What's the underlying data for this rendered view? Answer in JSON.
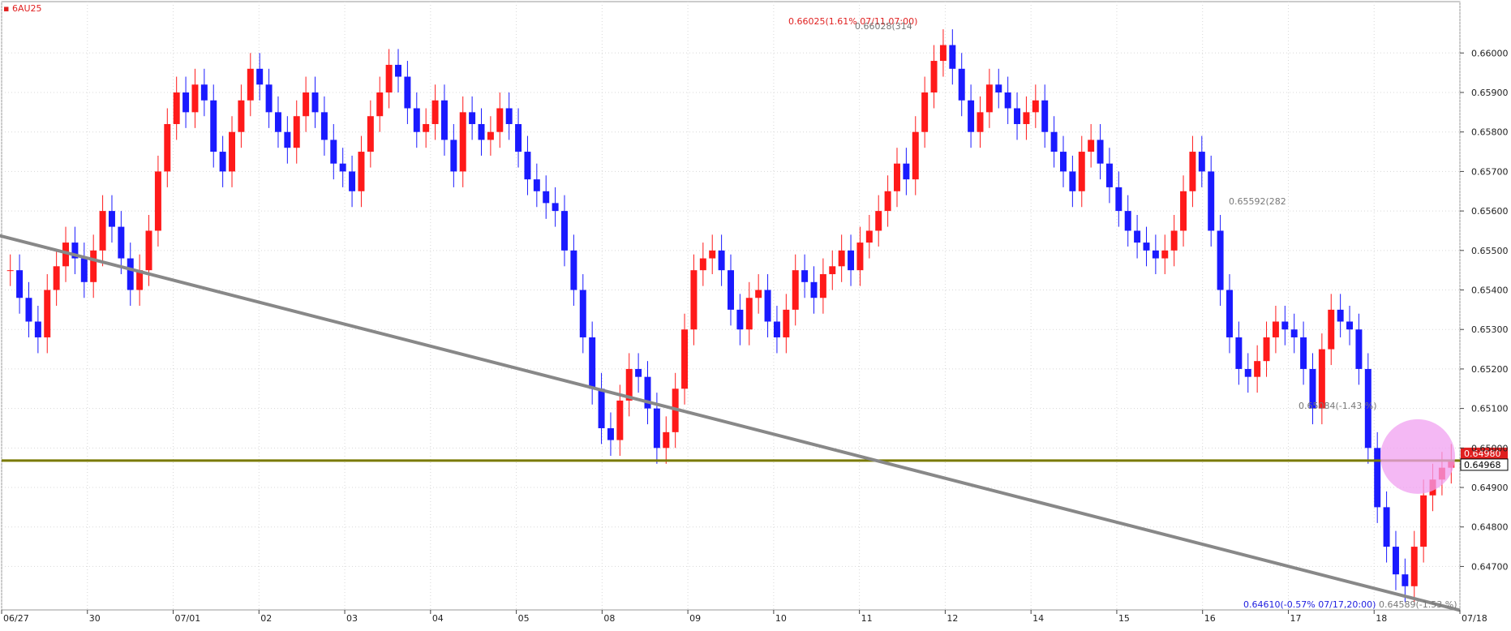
{
  "symbol": "6AU25",
  "colors": {
    "up": "#ff1a1a",
    "down": "#1a1aff",
    "grid": "#d8d8d8",
    "trend": "#888888",
    "hline": "#7a7a00",
    "highlight": "#f0a0f0",
    "price_tag_bg": "#e02020"
  },
  "current_price_label": "0.64968",
  "price_tag_values": [
    "0.64980",
    "0.64968"
  ],
  "annotations": {
    "high_label": "0.66025(1.61% 07/11,07:00)",
    "high_trend_label": "0.66028(314",
    "mid_label": "0.65592(282",
    "mid_low_label": "0.65084(-1.43 %)",
    "low_label": "0.64610(-0.57% 07/17,20:00)",
    "low_trend_label": "0.64589(-1.53 %)"
  },
  "chart_data": {
    "type": "candlestick",
    "title": "6AU25",
    "ylim": [
      0.6459,
      0.6613
    ],
    "yticks": [
      "0.66000",
      "0.65900",
      "0.65800",
      "0.65700",
      "0.65600",
      "0.65500",
      "0.65400",
      "0.65300",
      "0.65200",
      "0.65100",
      "0.65000",
      "0.64900",
      "0.64800",
      "0.64700"
    ],
    "xtick_labels": [
      "06/27",
      "30",
      "07/01",
      "02",
      "03",
      "04",
      "05",
      "08",
      "09",
      "10",
      "11",
      "12",
      "14",
      "15",
      "16",
      "17",
      "18",
      "07/18"
    ],
    "horizontal_line": 0.64968,
    "trendlines": [
      {
        "from": [
          0.66025,
          "07/11"
        ],
        "to": [
          0.65084,
          "07/17"
        ]
      },
      {
        "from": [
          0.65592,
          "07/17"
        ],
        "to": [
          0.64589,
          "07/18"
        ]
      }
    ],
    "series_close": [
      0.6545,
      0.6538,
      0.6532,
      0.6528,
      0.654,
      0.6546,
      0.6552,
      0.6548,
      0.6542,
      0.655,
      0.656,
      0.6556,
      0.6548,
      0.654,
      0.6545,
      0.6555,
      0.657,
      0.6582,
      0.659,
      0.6585,
      0.6592,
      0.6588,
      0.6575,
      0.657,
      0.658,
      0.6588,
      0.6596,
      0.6592,
      0.6585,
      0.658,
      0.6576,
      0.6584,
      0.659,
      0.6585,
      0.6578,
      0.6572,
      0.657,
      0.6565,
      0.6575,
      0.6584,
      0.659,
      0.6597,
      0.6594,
      0.6586,
      0.658,
      0.6582,
      0.6588,
      0.6578,
      0.657,
      0.6585,
      0.6582,
      0.6578,
      0.658,
      0.6586,
      0.6582,
      0.6575,
      0.6568,
      0.6565,
      0.6562,
      0.656,
      0.655,
      0.654,
      0.6528,
      0.6515,
      0.6505,
      0.6502,
      0.6512,
      0.652,
      0.6518,
      0.651,
      0.65,
      0.6504,
      0.6515,
      0.653,
      0.6545,
      0.6548,
      0.655,
      0.6545,
      0.6535,
      0.653,
      0.6538,
      0.654,
      0.6532,
      0.6528,
      0.6535,
      0.6545,
      0.6542,
      0.6538,
      0.6544,
      0.6546,
      0.655,
      0.6545,
      0.6552,
      0.6555,
      0.656,
      0.6565,
      0.6572,
      0.6568,
      0.658,
      0.659,
      0.6598,
      0.6602,
      0.6596,
      0.6588,
      0.658,
      0.6585,
      0.6592,
      0.659,
      0.6586,
      0.6582,
      0.6585,
      0.6588,
      0.658,
      0.6575,
      0.657,
      0.6565,
      0.6575,
      0.6578,
      0.6572,
      0.6566,
      0.656,
      0.6555,
      0.6552,
      0.655,
      0.6548,
      0.655,
      0.6555,
      0.6565,
      0.6575,
      0.657,
      0.6555,
      0.654,
      0.6528,
      0.652,
      0.6518,
      0.6522,
      0.6528,
      0.6532,
      0.653,
      0.6528,
      0.652,
      0.651,
      0.6525,
      0.6535,
      0.6532,
      0.653,
      0.652,
      0.65,
      0.6485,
      0.6475,
      0.6468,
      0.6465,
      0.6475,
      0.6488,
      0.6492,
      0.6495,
      0.6497
    ]
  }
}
